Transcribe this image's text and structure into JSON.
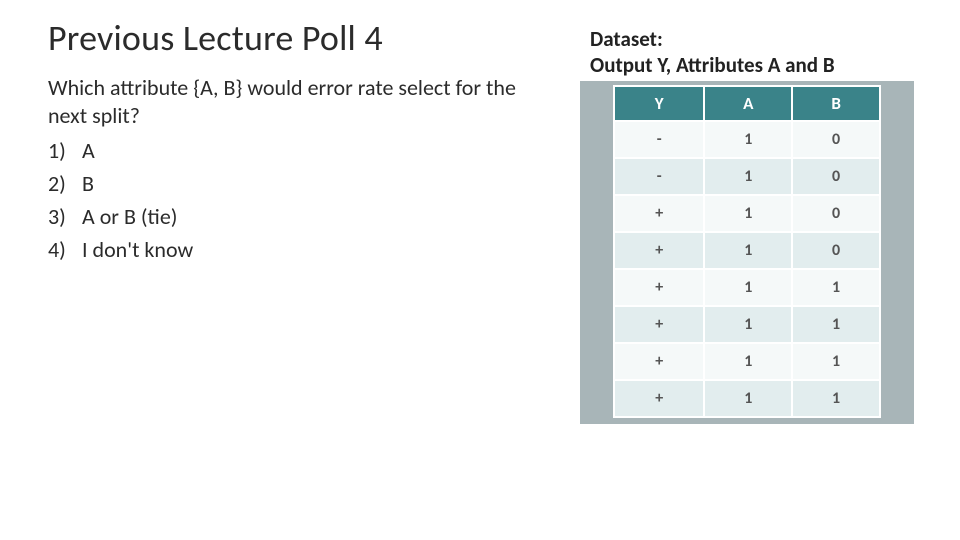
{
  "title": "Previous Lecture Poll 4",
  "question": "Which attribute {A, B} would error rate select for the next split?",
  "options": [
    {
      "num": "1)",
      "text": "A"
    },
    {
      "num": "2)",
      "text": "B"
    },
    {
      "num": "3)",
      "text": "A or B (tie)"
    },
    {
      "num": "4)",
      "text": "I don't know"
    }
  ],
  "dataset": {
    "label_line1": "Dataset:",
    "label_line2": "Output Y, Attributes A and B",
    "headers": [
      "Y",
      "A",
      "B"
    ],
    "rows": [
      [
        "-",
        "1",
        "0"
      ],
      [
        "-",
        "1",
        "0"
      ],
      [
        "+",
        "1",
        "0"
      ],
      [
        "+",
        "1",
        "0"
      ],
      [
        "+",
        "1",
        "1"
      ],
      [
        "+",
        "1",
        "1"
      ],
      [
        "+",
        "1",
        "1"
      ],
      [
        "+",
        "1",
        "1"
      ]
    ]
  },
  "chart_data": {
    "type": "table",
    "title": "Dataset: Output Y, Attributes A and B",
    "columns": [
      "Y",
      "A",
      "B"
    ],
    "rows": [
      [
        "-",
        1,
        0
      ],
      [
        "-",
        1,
        0
      ],
      [
        "+",
        1,
        0
      ],
      [
        "+",
        1,
        0
      ],
      [
        "+",
        1,
        1
      ],
      [
        "+",
        1,
        1
      ],
      [
        "+",
        1,
        1
      ],
      [
        "+",
        1,
        1
      ]
    ]
  }
}
